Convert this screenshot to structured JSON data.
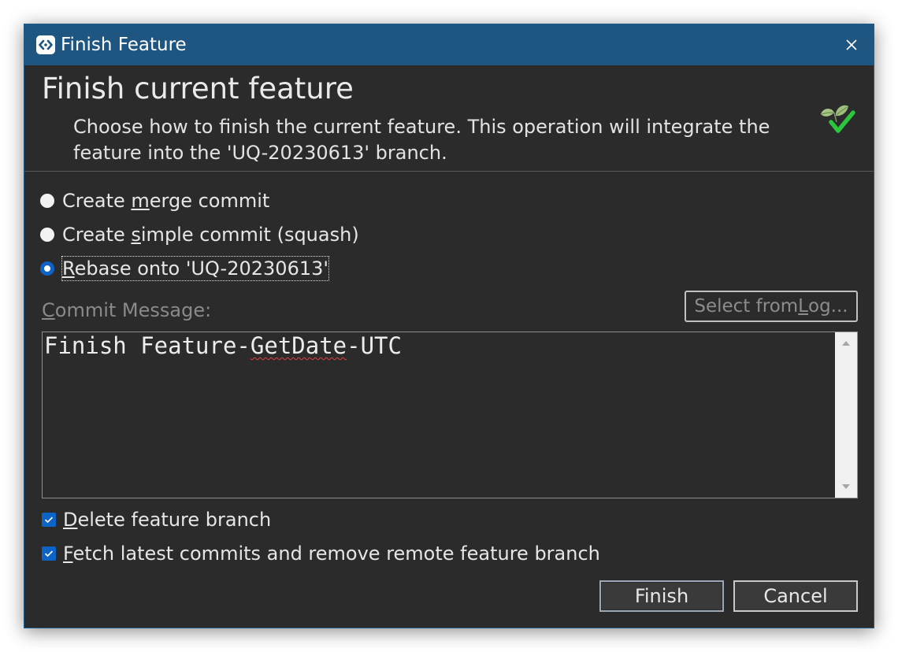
{
  "window": {
    "title": "Finish Feature",
    "icon": "app-logo-icon",
    "close_icon": "close-icon"
  },
  "header": {
    "title": "Finish current feature",
    "description": "Choose how to finish the current feature. This operation will integrate the feature into the 'UQ-20230613' branch.",
    "graphic": "leaves-checkmark-icon"
  },
  "options": [
    {
      "pre": "Create ",
      "key": "m",
      "post": "erge commit",
      "checked": false
    },
    {
      "pre": "Create ",
      "key": "s",
      "post": "imple commit (squash)",
      "checked": false
    },
    {
      "pre": "",
      "key": "R",
      "post": "ebase onto 'UQ-20230613'",
      "checked": true
    }
  ],
  "commit_message": {
    "label_key": "C",
    "label_rest": "ommit Message:",
    "select_pre": "Select from ",
    "select_key": "L",
    "select_post": "og...",
    "text_pre": "Finish Feature-",
    "text_misspelled": "GetDate",
    "text_post": "-UTC"
  },
  "checkboxes": [
    {
      "key": "D",
      "rest": "elete feature branch",
      "checked": true
    },
    {
      "key": "F",
      "rest": "etch latest commits and remove remote feature branch",
      "checked": true
    }
  ],
  "buttons": {
    "finish": "Finish",
    "cancel": "Cancel"
  },
  "colors": {
    "titlebar": "#1f5581",
    "background": "#2b2b2b",
    "accent": "#0e63c7"
  }
}
